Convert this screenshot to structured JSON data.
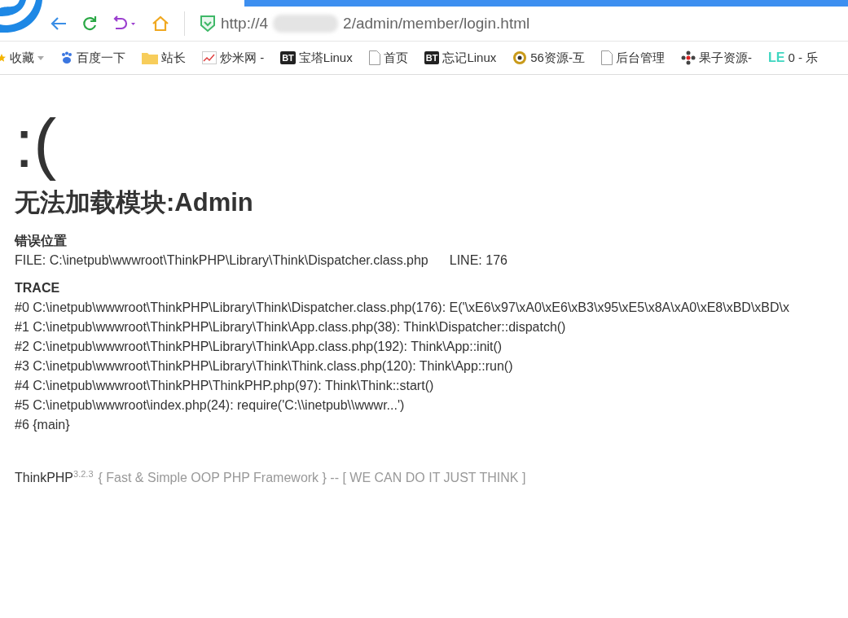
{
  "address_bar": {
    "url_start": "http://4",
    "url_end": "2/admin/member/login.html"
  },
  "bookmarks": [
    {
      "label": "收藏",
      "kind": "star"
    },
    {
      "label": "百度一下",
      "kind": "paw"
    },
    {
      "label": "站长",
      "kind": "folder"
    },
    {
      "label": "炒米网 -",
      "kind": "chart"
    },
    {
      "label": "宝塔Linux",
      "kind": "bt",
      "badge": "BT"
    },
    {
      "label": "首页",
      "kind": "page"
    },
    {
      "label": "忘记Linux",
      "kind": "bt",
      "badge": "BT"
    },
    {
      "label": "56资源-互",
      "kind": "coin"
    },
    {
      "label": "后台管理",
      "kind": "page"
    },
    {
      "label": "果子资源-",
      "kind": "dots"
    },
    {
      "label": "0 - 乐",
      "kind": "le",
      "badge": "LE"
    }
  ],
  "error": {
    "face": ":(",
    "title": "无法加载模块:Admin",
    "location_heading": "错误位置",
    "file": "FILE: C:\\inetpub\\wwwroot\\ThinkPHP\\Library\\Think\\Dispatcher.class.php",
    "line": "LINE: 176",
    "trace_heading": "TRACE",
    "trace": [
      "#0 C:\\inetpub\\wwwroot\\ThinkPHP\\Library\\Think\\Dispatcher.class.php(176): E('\\xE6\\x97\\xA0\\xE6\\xB3\\x95\\xE5\\x8A\\xA0\\xE8\\xBD\\xBD\\x",
      "#1 C:\\inetpub\\wwwroot\\ThinkPHP\\Library\\Think\\App.class.php(38): Think\\Dispatcher::dispatch()",
      "#2 C:\\inetpub\\wwwroot\\ThinkPHP\\Library\\Think\\App.class.php(192): Think\\App::init()",
      "#3 C:\\inetpub\\wwwroot\\ThinkPHP\\Library\\Think\\Think.class.php(120): Think\\App::run()",
      "#4 C:\\inetpub\\wwwroot\\ThinkPHP\\ThinkPHP.php(97): Think\\Think::start()",
      "#5 C:\\inetpub\\wwwroot\\index.php(24): require('C:\\\\inetpub\\\\wwwr...')",
      "#6 {main}"
    ]
  },
  "footer": {
    "brand": "ThinkPHP",
    "version": "3.2.3",
    "slogan": "{ Fast & Simple OOP PHP Framework } -- [ WE CAN DO IT JUST THINK ]"
  }
}
